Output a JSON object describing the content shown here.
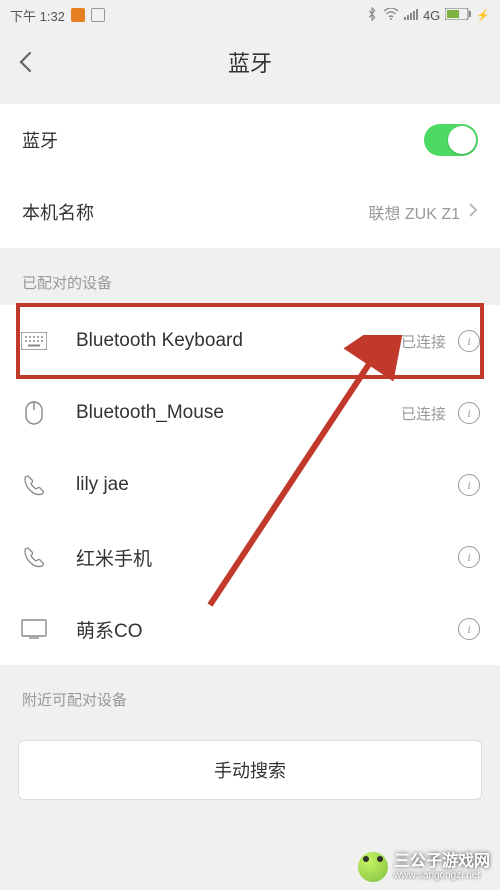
{
  "status_bar": {
    "time": "下午 1:32",
    "network": "4G"
  },
  "header": {
    "title": "蓝牙"
  },
  "settings": {
    "bluetooth_label": "蓝牙",
    "bluetooth_on": true,
    "device_name_label": "本机名称",
    "device_name_value": "联想 ZUK Z1"
  },
  "paired_section": {
    "title": "已配对的设备",
    "devices": [
      {
        "icon": "keyboard",
        "name": "Bluetooth Keyboard",
        "status": "已连接",
        "highlighted": true
      },
      {
        "icon": "mouse",
        "name": "Bluetooth_Mouse",
        "status": "已连接"
      },
      {
        "icon": "phone",
        "name": "lily jae",
        "status": ""
      },
      {
        "icon": "phone",
        "name": "红米手机",
        "status": ""
      },
      {
        "icon": "display",
        "name": "萌系CO",
        "status": ""
      }
    ]
  },
  "nearby_section": {
    "title": "附近可配对设备",
    "search_button": "手动搜索"
  },
  "watermark": {
    "text": "三公子游戏网",
    "url": "www.sangongzi.net"
  }
}
